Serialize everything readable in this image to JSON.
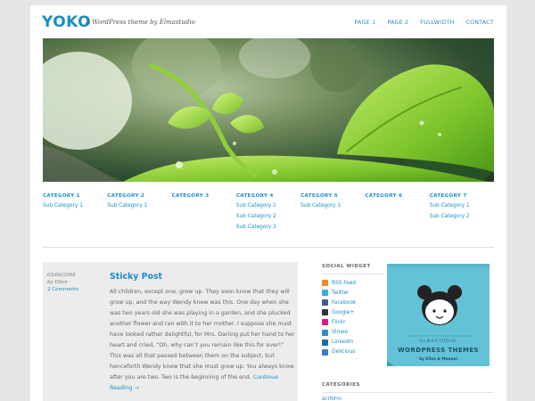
{
  "site": {
    "logo": "YOKO",
    "tagline": "A WordPress theme by Elmastudio"
  },
  "topnav": [
    "PAGE 1",
    "PAGE 2",
    "FULLWIDTH",
    "CONTACT"
  ],
  "categories": [
    {
      "title": "CATEGORY 1",
      "subs": [
        "Sub Category 1"
      ]
    },
    {
      "title": "CATEGORY 2",
      "subs": [
        "Sub Category 1"
      ]
    },
    {
      "title": "CATEGORY 3",
      "subs": []
    },
    {
      "title": "CATEGORY 4",
      "subs": [
        "Sub Category 1",
        "Sub Category 2",
        "Sub Category 3"
      ]
    },
    {
      "title": "CATEGORY 5",
      "subs": [
        "Sub Category 1"
      ]
    },
    {
      "title": "CATEGORY 6",
      "subs": []
    },
    {
      "title": "CATEGORY 7",
      "subs": [
        "Sub Category 1",
        "Sub Category 2"
      ]
    }
  ],
  "post": {
    "date": "05/06/2008",
    "author": "by Ellen",
    "comments": "2 Comments",
    "title": "Sticky Post",
    "body": "All children, except one, grow up. They soon know that they will grow up, and the way Wendy knew was this. One day when she was two years old she was playing in a garden, and she plucked another flower and ran with it to her mother. I suppose she must have looked rather delightful, for Mrs. Darling put her hand to her heart and cried, “Oh, why can’t you remain like this for ever!” This was all that passed between them on the subject, but henceforth Wendy knew that she must grow up. You always know after you are two. Two is the beginning of the end.",
    "more": "Continue Reading →"
  },
  "sidebar": {
    "social_heading": "SOCIAL WIDGET",
    "social": [
      {
        "label": "RSS Feed",
        "icon": "rss-icon",
        "color": "#f08a24"
      },
      {
        "label": "Twitter",
        "icon": "twitter-icon",
        "color": "#39a9e0"
      },
      {
        "label": "Facebook",
        "icon": "facebook-icon",
        "color": "#3b5b98"
      },
      {
        "label": "Google+",
        "icon": "google-plus-icon",
        "color": "#333333"
      },
      {
        "label": "Flickr",
        "icon": "flickr-icon",
        "color": "#d81c7f"
      },
      {
        "label": "Vimeo",
        "icon": "vimeo-icon",
        "color": "#2f8fc0"
      },
      {
        "label": "LinkedIn",
        "icon": "linkedin-icon",
        "color": "#1b6ea3"
      },
      {
        "label": "Delicious",
        "icon": "delicious-icon",
        "color": "#3b76d1"
      }
    ],
    "categories_heading": "CATEGORIES",
    "first_category": "aciform"
  },
  "badge": {
    "line1": "ELMASTUDIO",
    "line2": "WORDPRESS THEMES",
    "line3": "by Ellen & Manuel",
    "bg": "#63c2d6"
  },
  "colors": {
    "accent": "#1a8ec4"
  }
}
